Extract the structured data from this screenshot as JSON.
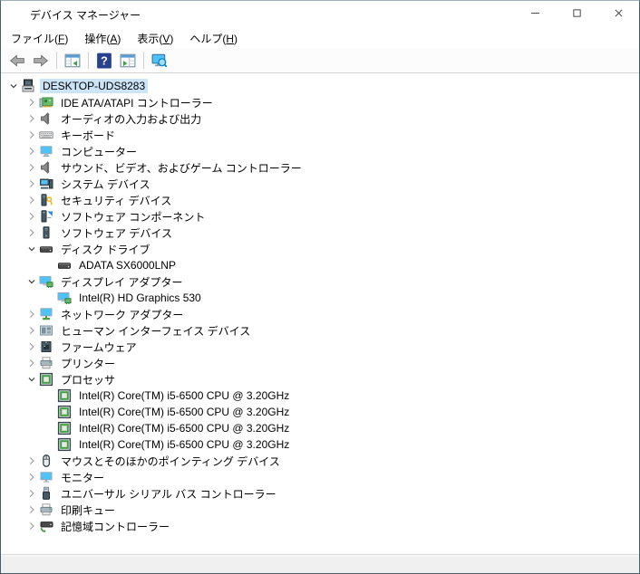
{
  "window": {
    "title": "デバイス マネージャー",
    "title_icon": "device-manager-icon",
    "controls": [
      {
        "name": "minimize-button",
        "icon": "minimize-icon"
      },
      {
        "name": "maximize-button",
        "icon": "maximize-icon"
      },
      {
        "name": "close-button",
        "icon": "close-icon"
      }
    ]
  },
  "menu": {
    "items": [
      {
        "label": "ファイル(F)"
      },
      {
        "label": "操作(A)"
      },
      {
        "label": "表示(V)"
      },
      {
        "label": "ヘルプ(H)"
      }
    ]
  },
  "toolbar": {
    "items": [
      {
        "type": "button",
        "icon": "back-arrow-icon"
      },
      {
        "type": "button",
        "icon": "forward-arrow-icon"
      },
      {
        "type": "sep"
      },
      {
        "type": "button",
        "icon": "console-tree-icon"
      },
      {
        "type": "sep"
      },
      {
        "type": "button",
        "icon": "help-icon"
      },
      {
        "type": "button",
        "icon": "action-pane-icon"
      },
      {
        "type": "sep"
      },
      {
        "type": "button",
        "icon": "scan-hardware-icon"
      }
    ]
  },
  "tree": {
    "items": [
      {
        "label": "DESKTOP-UDS8283",
        "icon": "computer-icon",
        "level": 0,
        "expand": "expanded",
        "selected": true
      },
      {
        "label": "IDE ATA/ATAPI コントローラー",
        "icon": "ide-controller-icon",
        "level": 1,
        "expand": "collapsed"
      },
      {
        "label": "オーディオの入力および出力",
        "icon": "audio-icon",
        "level": 1,
        "expand": "collapsed"
      },
      {
        "label": "キーボード",
        "icon": "keyboard-icon",
        "level": 1,
        "expand": "collapsed"
      },
      {
        "label": "コンピューター",
        "icon": "computer-category-icon",
        "level": 1,
        "expand": "collapsed"
      },
      {
        "label": "サウンド、ビデオ、およびゲーム コントローラー",
        "icon": "sound-icon",
        "level": 1,
        "expand": "collapsed"
      },
      {
        "label": "システム デバイス",
        "icon": "system-devices-icon",
        "level": 1,
        "expand": "collapsed"
      },
      {
        "label": "セキュリティ デバイス",
        "icon": "security-device-icon",
        "level": 1,
        "expand": "collapsed"
      },
      {
        "label": "ソフトウェア コンポーネント",
        "icon": "software-component-icon",
        "level": 1,
        "expand": "collapsed"
      },
      {
        "label": "ソフトウェア デバイス",
        "icon": "software-device-icon",
        "level": 1,
        "expand": "collapsed"
      },
      {
        "label": "ディスク ドライブ",
        "icon": "disk-drive-icon",
        "level": 1,
        "expand": "expanded"
      },
      {
        "label": "ADATA SX6000LNP",
        "icon": "disk-drive-icon",
        "level": 2,
        "expand": "none"
      },
      {
        "label": "ディスプレイ アダプター",
        "icon": "display-adapter-icon",
        "level": 1,
        "expand": "expanded"
      },
      {
        "label": "Intel(R) HD Graphics 530",
        "icon": "display-adapter-icon",
        "level": 2,
        "expand": "none"
      },
      {
        "label": "ネットワーク アダプター",
        "icon": "network-adapter-icon",
        "level": 1,
        "expand": "collapsed"
      },
      {
        "label": "ヒューマン インターフェイス デバイス",
        "icon": "hid-icon",
        "level": 1,
        "expand": "collapsed"
      },
      {
        "label": "ファームウェア",
        "icon": "firmware-icon",
        "level": 1,
        "expand": "collapsed"
      },
      {
        "label": "プリンター",
        "icon": "printer-icon",
        "level": 1,
        "expand": "collapsed"
      },
      {
        "label": "プロセッサ",
        "icon": "processor-icon",
        "level": 1,
        "expand": "expanded"
      },
      {
        "label": "Intel(R) Core(TM) i5-6500 CPU @ 3.20GHz",
        "icon": "processor-icon",
        "level": 2,
        "expand": "none"
      },
      {
        "label": "Intel(R) Core(TM) i5-6500 CPU @ 3.20GHz",
        "icon": "processor-icon",
        "level": 2,
        "expand": "none"
      },
      {
        "label": "Intel(R) Core(TM) i5-6500 CPU @ 3.20GHz",
        "icon": "processor-icon",
        "level": 2,
        "expand": "none"
      },
      {
        "label": "Intel(R) Core(TM) i5-6500 CPU @ 3.20GHz",
        "icon": "processor-icon",
        "level": 2,
        "expand": "none"
      },
      {
        "label": "マウスとそのほかのポインティング デバイス",
        "icon": "mouse-icon",
        "level": 1,
        "expand": "collapsed"
      },
      {
        "label": "モニター",
        "icon": "monitor-icon",
        "level": 1,
        "expand": "collapsed"
      },
      {
        "label": "ユニバーサル シリアル バス コントローラー",
        "icon": "usb-icon",
        "level": 1,
        "expand": "collapsed"
      },
      {
        "label": "印刷キュー",
        "icon": "print-queue-icon",
        "level": 1,
        "expand": "collapsed"
      },
      {
        "label": "記憶域コントローラー",
        "icon": "storage-controller-icon",
        "level": 1,
        "expand": "collapsed"
      }
    ]
  },
  "statusbar": {
    "text": ""
  },
  "colors": {
    "window_border": "#44606c",
    "selection_bg": "#cce4f7",
    "help_button_blue": "#28418f",
    "statusbar_bg": "#f0f0f0",
    "device_blue": "#4fc3f7",
    "device_green": "#66bb6a"
  }
}
